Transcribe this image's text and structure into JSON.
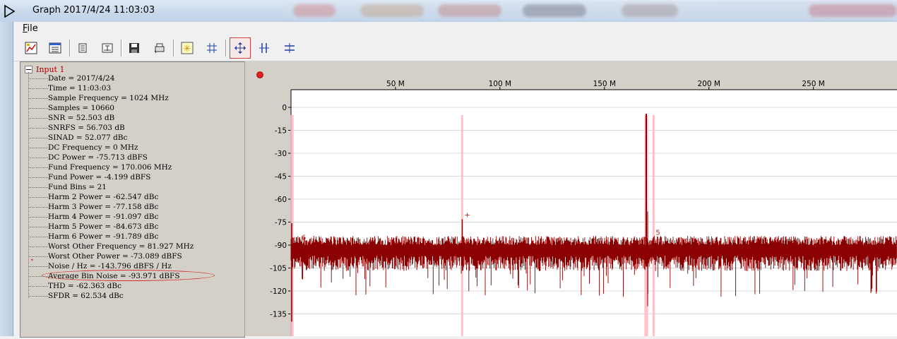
{
  "window": {
    "title": "Graph 2017/4/24 11:03:03"
  },
  "menu": {
    "file_label": "File"
  },
  "toolbar": {
    "icons": [
      "chart-wizard-icon",
      "table-icon",
      "list-icon",
      "text-export-icon",
      "save-icon",
      "print-icon",
      "star-icon",
      "grid-icon",
      "move-cursor-icon",
      "vertical-split-icon",
      "horizontal-split-icon"
    ],
    "active_icon": "move-cursor-icon"
  },
  "tree": {
    "root_label": "Input 1",
    "items": [
      "Date = 2017/4/24",
      "Time = 11:03:03",
      "Sample Frequency = 1024 MHz",
      "Samples = 10660",
      "SNR = 52.503 dB",
      "SNRFS = 56.703 dB",
      "SINAD = 52.077 dBc",
      "DC Frequency = 0 MHz",
      "DC Power = -75.713 dBFS",
      "Fund Frequency = 170.006 MHz",
      "Fund Power = -4.199 dBFS",
      "Fund Bins = 21",
      "Harm 2 Power = -62.547 dBc",
      "Harm 3 Power = -77.158 dBc",
      "Harm 4 Power = -91.097 dBc",
      "Harm 5 Power = -84.673 dBc",
      "Harm 6 Power = -91.789 dBc",
      "Worst Other Frequency = 81.927 MHz",
      "Worst Other Power = -73.089 dBFS",
      "Noise / Hz = -143.796 dBFS / Hz",
      "Average Bin Noise = -93.971 dBFS",
      "THD = -62.363 dBc",
      "SFDR = 62.534 dBc"
    ],
    "highlighted_item": "Average Bin Noise = -93.971 dBFS"
  },
  "chart_data": {
    "type": "line",
    "x_unit": "MHz",
    "x_ticks": [
      {
        "value": 50,
        "label": "50 M"
      },
      {
        "value": 100,
        "label": "100 M"
      },
      {
        "value": 150,
        "label": "150 M"
      },
      {
        "value": 200,
        "label": "200 M"
      },
      {
        "value": 250,
        "label": "250 M"
      }
    ],
    "y_ticks": [
      0,
      -15,
      -30,
      -45,
      -60,
      -75,
      -90,
      -105,
      -120,
      -135
    ],
    "xlim": [
      0,
      290
    ],
    "ylim": [
      -150,
      0
    ],
    "noise_floor": -94,
    "fundamental": {
      "x": 170.006,
      "y": -4.2
    },
    "spurs": [
      {
        "x": 81.927,
        "y": -73.1,
        "label": "+"
      },
      {
        "x": 173.5,
        "y": -84.7,
        "label": "5"
      },
      {
        "x": 4,
        "y": -88,
        "label": "6"
      }
    ],
    "marker_bins": [
      {
        "x": 0.5,
        "width": 1.5
      },
      {
        "x": 81.9,
        "width": 1
      },
      {
        "x": 170.0,
        "width": 1.8
      },
      {
        "x": 173.5,
        "width": 1
      }
    ],
    "grid": true,
    "colors": {
      "trace": "#8b0000",
      "marker": "#ffb6c1",
      "axis": "#000000",
      "plot_bg": "#ffffff"
    }
  }
}
